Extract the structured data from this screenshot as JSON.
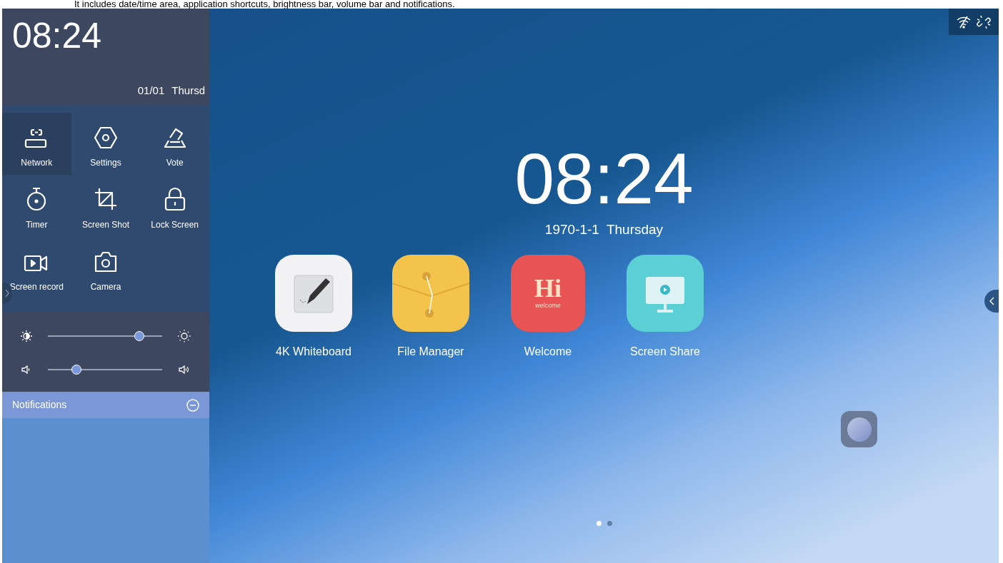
{
  "caption": "It includes date/time area, application shortcuts, brightness bar, volume bar and notifications.",
  "panel": {
    "time": "08:24",
    "date": "01/01",
    "weekday": "Thursd",
    "shortcuts": [
      {
        "label": "Network",
        "selected": true
      },
      {
        "label": "Settings",
        "selected": false
      },
      {
        "label": "Vote",
        "selected": false
      },
      {
        "label": "Timer",
        "selected": false
      },
      {
        "label": "Screen Shot",
        "selected": false
      },
      {
        "label": "Lock Screen",
        "selected": false
      },
      {
        "label": "Screen record",
        "selected": false
      },
      {
        "label": "Camera",
        "selected": false
      }
    ],
    "brightness": {
      "level": 0.8
    },
    "volume": {
      "level": 0.25
    },
    "notifications": {
      "title": "Notifications"
    }
  },
  "home": {
    "time": "08:24",
    "date": "1970-1-1",
    "weekday": "Thursday",
    "apps": [
      {
        "label": "4K Whiteboard"
      },
      {
        "label": "File Manager"
      },
      {
        "label": "Welcome",
        "icon_title": "Hi",
        "icon_subtitle": "welcome"
      },
      {
        "label": "Screen Share"
      }
    ],
    "page_dots": [
      {
        "selected": true
      },
      {
        "selected": false
      }
    ]
  }
}
